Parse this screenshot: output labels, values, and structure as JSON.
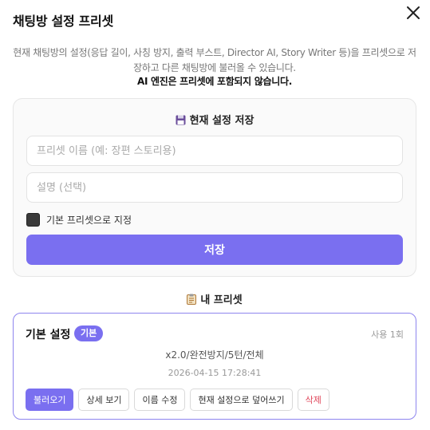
{
  "modal": {
    "title": "채팅방 설정 프리셋",
    "close_icon": "close-icon",
    "description": "현재 채팅방의 설정(응답 길이, 사칭 방지, 출력 부스트, Director AI, Story Writer 등)을 프리셋으로 저장하고 다른 채팅방에 불러올 수 있습니다.",
    "note": "AI 엔진은 프리셋에 포함되지 않습니다."
  },
  "save_section": {
    "icon": "floppy-disk-icon",
    "title": "현재 설정 저장",
    "name_placeholder": "프리셋 이름 (예: 장편 스토리용)",
    "name_value": "",
    "desc_placeholder": "설명 (선택)",
    "desc_value": "",
    "default_label": "기본 프리셋으로 지정",
    "save_label": "저장"
  },
  "my_presets": {
    "icon": "clipboard-icon",
    "title": "내 프리셋",
    "items": [
      {
        "name": "기본 설정",
        "badge": "기본",
        "usage": "사용 1회",
        "summary": "x2.0/완전방지/5턴/전체",
        "date": "2026-04-15 17:28:41",
        "actions": {
          "load": "불러오기",
          "details": "상세 보기",
          "rename": "이름 수정",
          "overwrite": "현재 설정으로 덮어쓰기",
          "delete": "삭제"
        }
      }
    ]
  },
  "colors": {
    "accent": "#7a6ff0",
    "danger": "#e0475b"
  }
}
